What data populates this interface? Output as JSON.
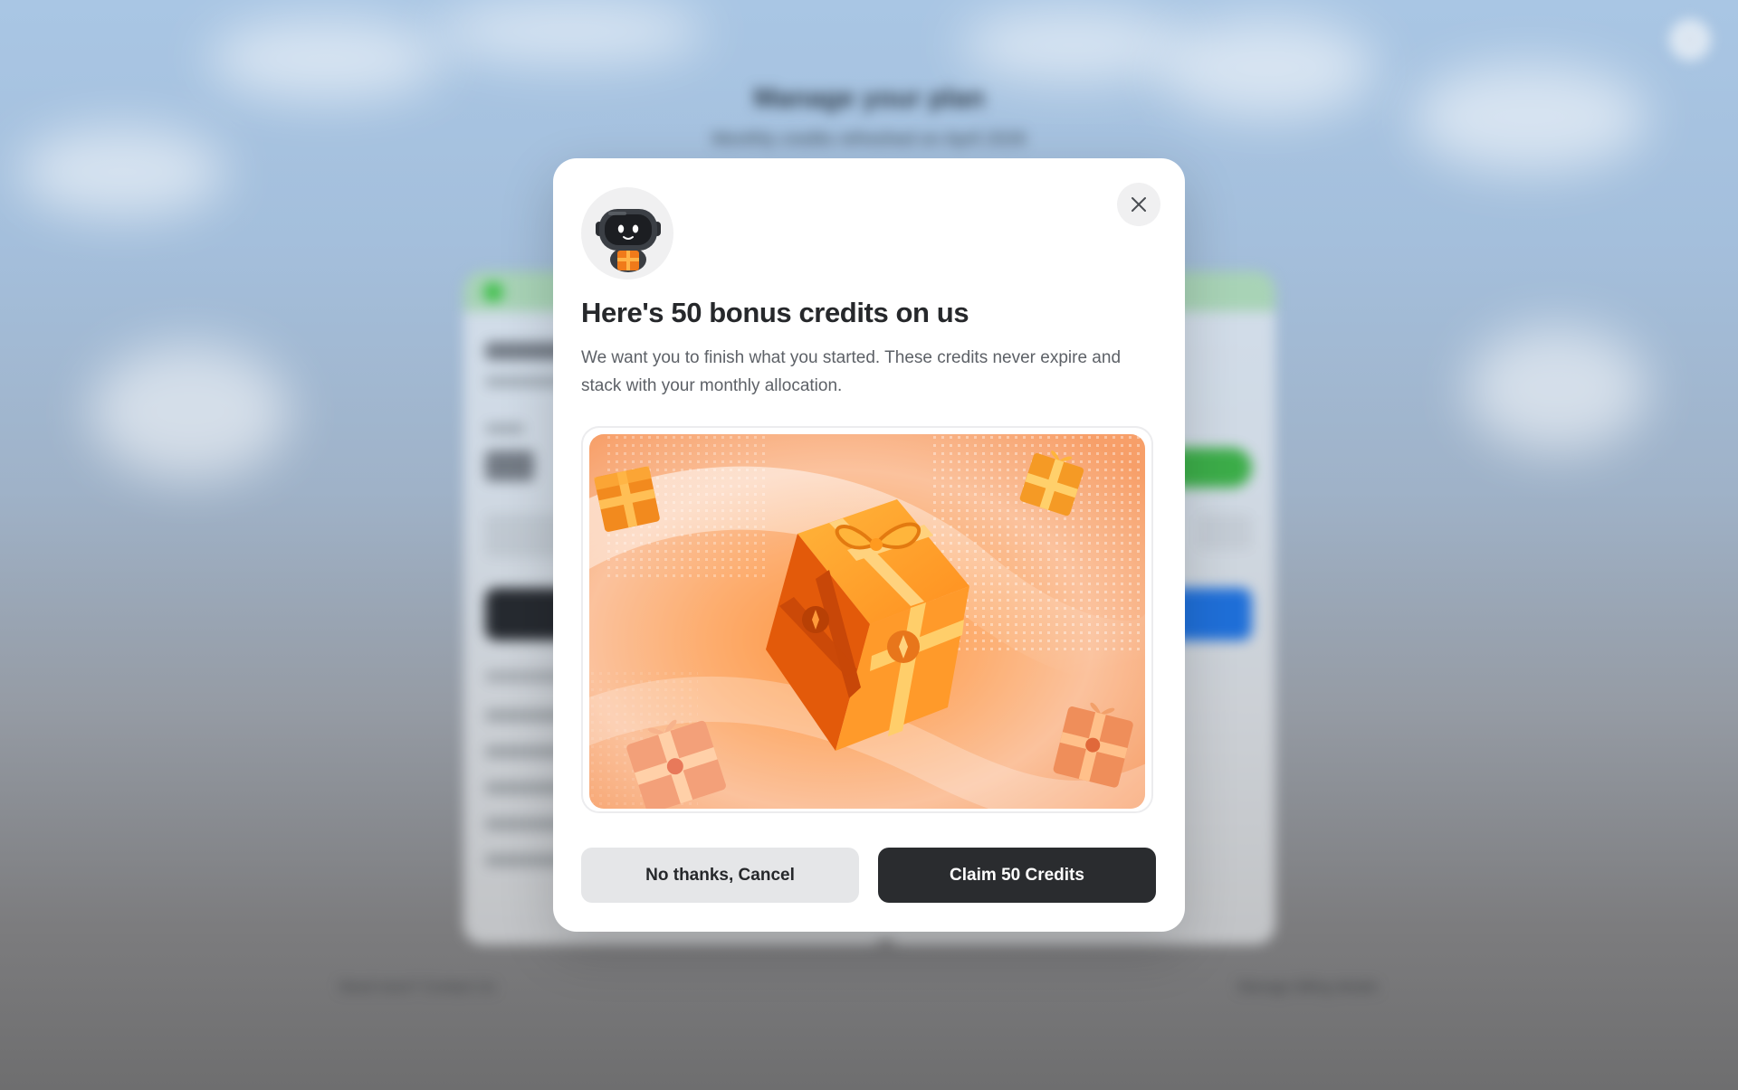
{
  "background": {
    "title": "Manage your plan",
    "subtitle": "Monthly credits refreshed on April 2026",
    "footer_left": "Need more? Contact Us",
    "footer_right": "Manage billing details"
  },
  "modal": {
    "heading": "Here's 50 bonus credits on us",
    "description": "We want you to finish what you started. These credits never expire and stack with your monthly allocation.",
    "cancel_label": "No thanks, Cancel",
    "claim_label": "Claim 50 Credits",
    "icons": [
      "close-icon",
      "robot-mascot-icon",
      "gift-icon"
    ]
  },
  "colors": {
    "primary_button": "#2a2c2f",
    "secondary_button": "#e5e6e8",
    "gift_orange": "#f07a1a",
    "heading_text": "#26282b"
  }
}
